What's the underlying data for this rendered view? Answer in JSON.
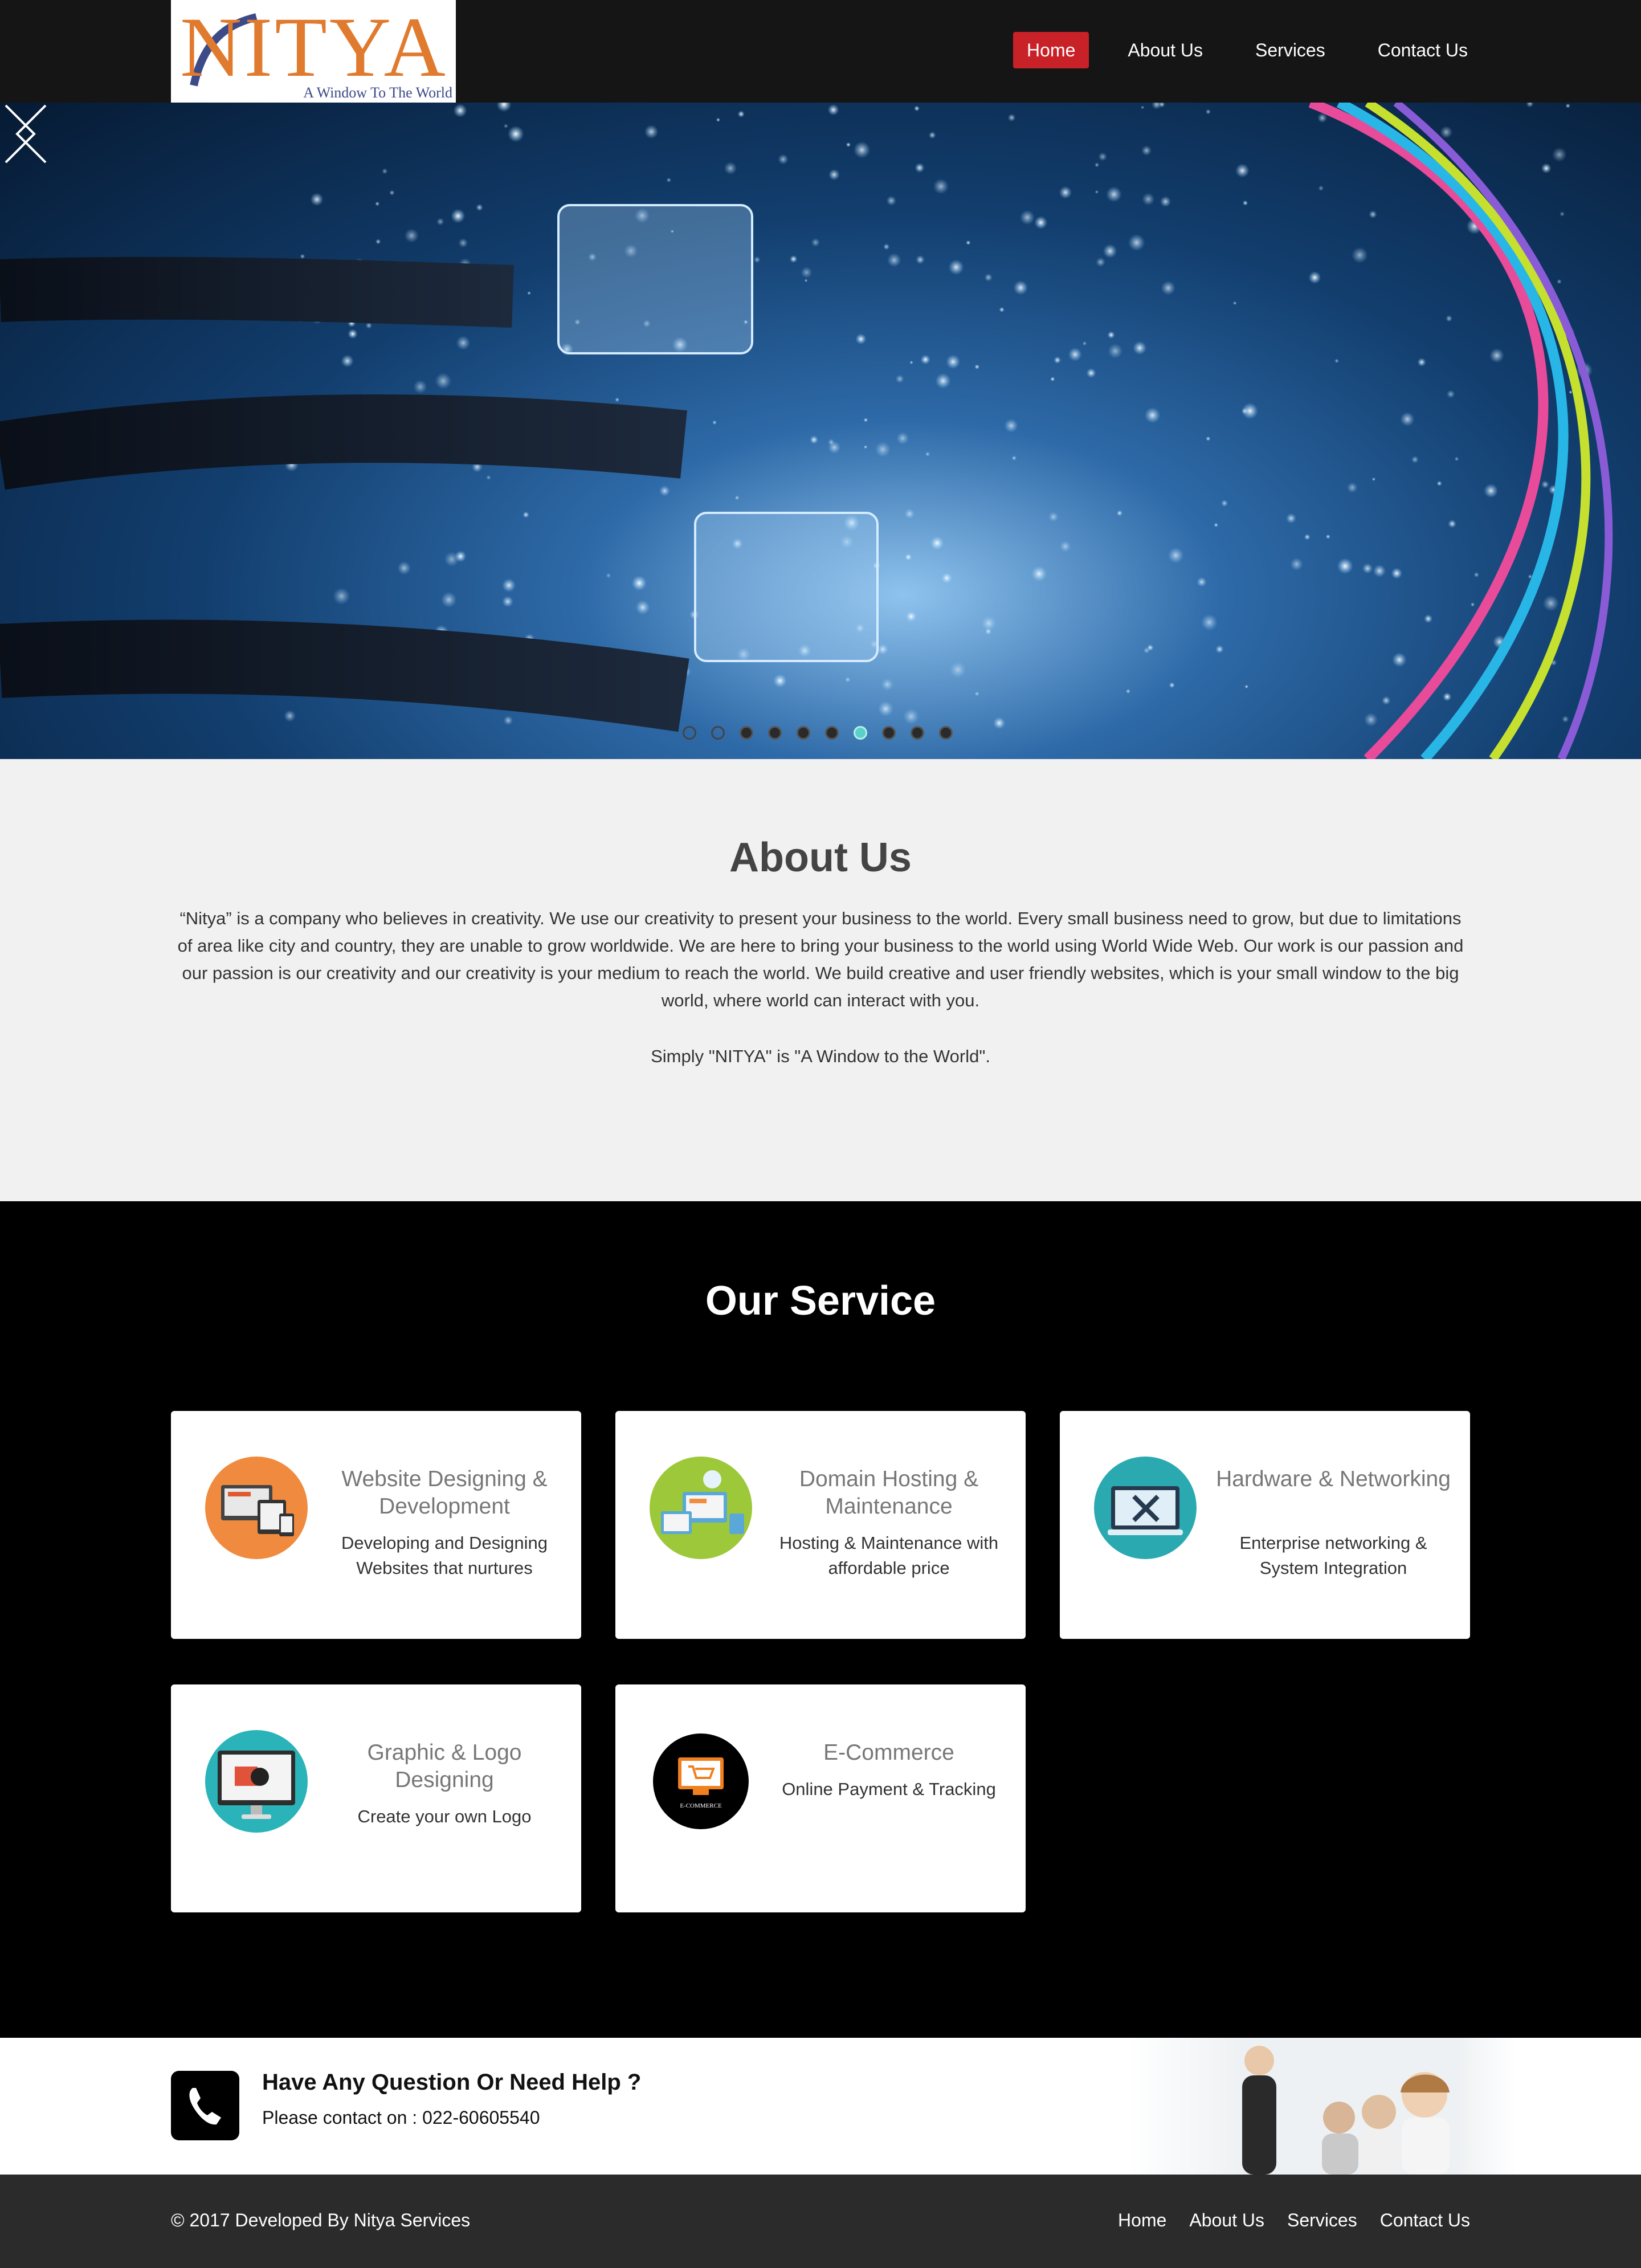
{
  "header": {
    "logo_text": "NITYA",
    "logo_tagline": "A Window To The World",
    "nav": [
      {
        "label": "Home",
        "active": true
      },
      {
        "label": "About Us",
        "active": false
      },
      {
        "label": "Services",
        "active": false
      },
      {
        "label": "Contact Us",
        "active": false
      }
    ]
  },
  "slider": {
    "slide_count": 10,
    "active_index": 6,
    "prev_icon": "chevron-left-icon",
    "next_icon": "chevron-right-icon"
  },
  "about": {
    "title": "About Us",
    "body": "“Nitya” is a company who believes in creativity. We use our creativity to present your business to the world. Every small business need to grow, but due to limitations of area like city and country, they are unable to grow worldwide. We are here to bring your business to the world using World Wide Web. Our work is our passion and our passion is our creativity and our creativity is your medium to reach the world. We build creative and user friendly websites, which is your small window to the big world, where world can interact with you.",
    "tagline": "Simply \"NITYA\" is \"A Window to the World\"."
  },
  "services": {
    "title": "Our Service",
    "items": [
      {
        "title": "Website Designing & Development",
        "desc": "Developing and Designing Websites that nurtures",
        "icon": "web-design-icon",
        "color": "#f08a3e"
      },
      {
        "title": "Domain Hosting & Maintenance",
        "desc": "Hosting & Maintenance with affordable price",
        "icon": "hosting-icon",
        "color": "#9cc83a"
      },
      {
        "title": "Hardware & Networking",
        "desc": "Enterprise networking & System Integration",
        "icon": "networking-icon",
        "color": "#2aaab0"
      },
      {
        "title": "Graphic & Logo Designing",
        "desc": "Create your own Logo",
        "icon": "graphic-design-icon",
        "color": "#2ab3b8"
      },
      {
        "title": "E-Commerce",
        "desc": "Online Payment & Tracking",
        "icon": "ecommerce-icon",
        "color": "#000000",
        "badge": "E-COMMERCE"
      }
    ]
  },
  "help": {
    "heading": "Have Any Question Or Need Help ?",
    "contact": "Please contact on : 022-60605540",
    "icon": "phone-icon"
  },
  "footer": {
    "copyright": "© 2017 Developed By Nitya Services",
    "nav": [
      "Home",
      "About Us",
      "Services",
      "Contact Us"
    ]
  },
  "colors": {
    "header_bg": "#151515",
    "active_nav": "#c82128",
    "about_bg": "#f1f1f1",
    "services_bg": "#000000",
    "footer_bg": "#2b2b2b"
  }
}
